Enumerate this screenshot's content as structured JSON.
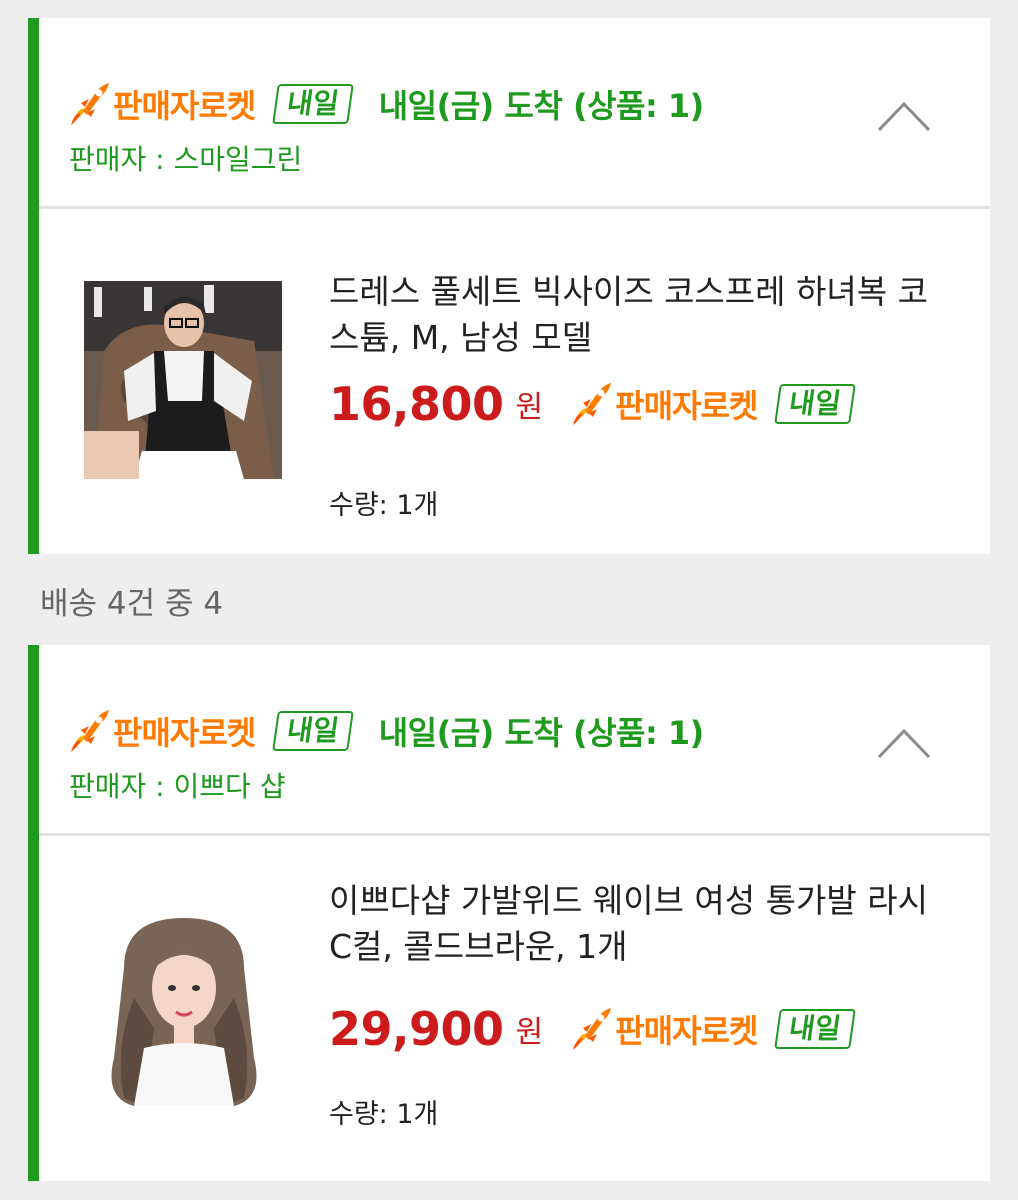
{
  "section_label": "배송 4건 중 4",
  "colors": {
    "green": "#1e9a1e",
    "orange": "#ff7a00",
    "price_red": "#cc1b1b"
  },
  "shipments": [
    {
      "brand": "판매자로켓",
      "badge": "내일",
      "arrival": "내일(금) 도착 (상품: 1)",
      "seller": "판매자 : 스마일그린",
      "collapse_icon": "chevron-up-icon",
      "item": {
        "image": "maid-costume-model-photo",
        "title": "드레스 풀세트 빅사이즈 코스프레 하녀복 코스튬, M, 남성 모델",
        "price": "16,800",
        "unit": "원",
        "brand": "판매자로켓",
        "badge": "내일",
        "qty": "수량: 1개"
      }
    },
    {
      "brand": "판매자로켓",
      "badge": "내일",
      "arrival": "내일(금) 도착 (상품: 1)",
      "seller": "판매자 : 이쁘다 샵",
      "collapse_icon": "chevron-up-icon",
      "item": {
        "image": "wavy-wig-model-photo",
        "title": "이쁘다샵 가발위드 웨이브 여성 통가발 라시 C컬, 콜드브라운, 1개",
        "price": "29,900",
        "unit": "원",
        "brand": "판매자로켓",
        "badge": "내일",
        "qty": "수량: 1개"
      }
    }
  ]
}
